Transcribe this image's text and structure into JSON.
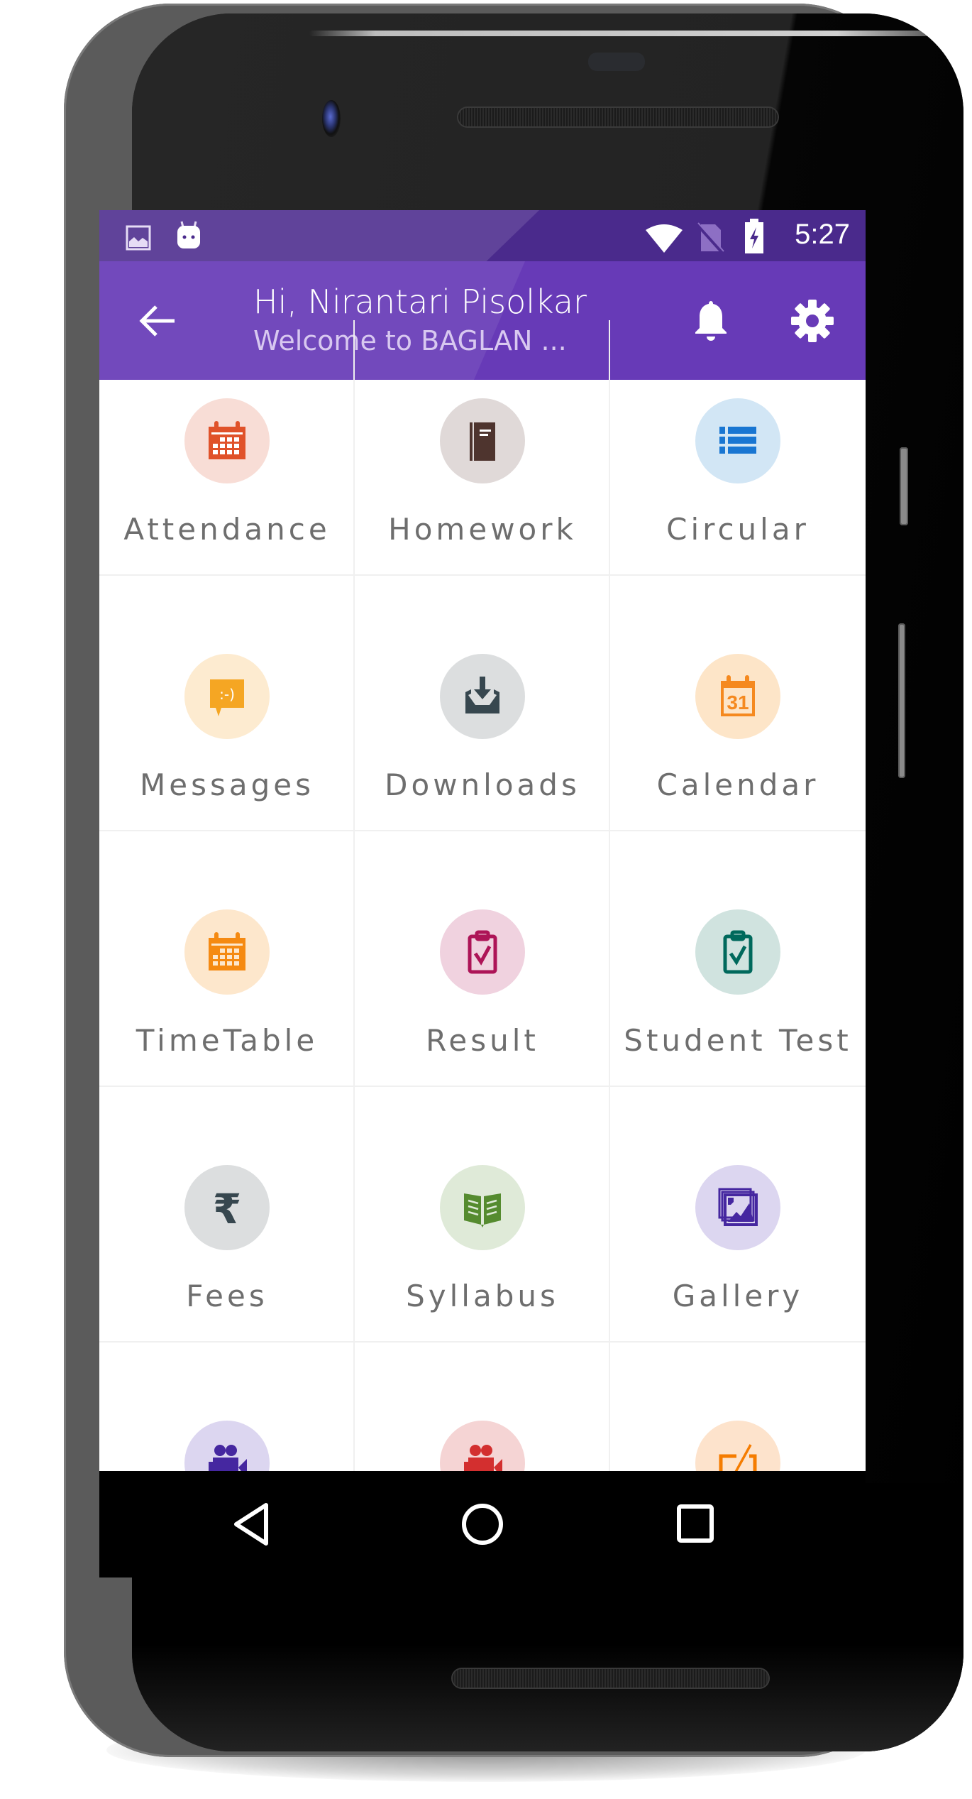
{
  "status_bar": {
    "left_icons": [
      "image-icon",
      "android-icon"
    ],
    "right_icons": [
      "wifi-icon",
      "no-sim-icon",
      "battery-charging-icon"
    ],
    "time": "5:27"
  },
  "app_bar": {
    "title": "Hi, Nirantari Pisolkar",
    "subtitle": "Welcome to BAGLAN ...",
    "back_icon": "arrow-back-icon",
    "actions": [
      "bell-icon",
      "gear-icon"
    ],
    "color": "#673ab7",
    "status_color": "#4a2a8c"
  },
  "menu": {
    "items": [
      {
        "label": "Attendance",
        "icon": "calendar-grid-icon",
        "bg": "#f8ddd6",
        "fg": "#e0522a"
      },
      {
        "label": "Homework",
        "icon": "book-icon",
        "bg": "#e0d9d8",
        "fg": "#4e342e"
      },
      {
        "label": "Circular",
        "icon": "list-icon",
        "bg": "#d2e6f5",
        "fg": "#1976d2"
      },
      {
        "label": "Messages",
        "icon": "chat-smiley-icon",
        "bg": "#fdebd0",
        "fg": "#f5a623"
      },
      {
        "label": "Downloads",
        "icon": "inbox-download-icon",
        "bg": "#dcdedf",
        "fg": "#37474f"
      },
      {
        "label": "Calendar",
        "icon": "calendar-31-icon",
        "bg": "#fde5c8",
        "fg": "#f5891f"
      },
      {
        "label": "TimeTable",
        "icon": "timetable-icon",
        "bg": "#fde7cc",
        "fg": "#f58a12"
      },
      {
        "label": "Result",
        "icon": "clipboard-check-icon",
        "bg": "#f0d2df",
        "fg": "#ad1457"
      },
      {
        "label": "Student Test",
        "icon": "clipboard-check-icon",
        "bg": "#d0e3df",
        "fg": "#00695c"
      },
      {
        "label": "Fees",
        "icon": "rupee-icon",
        "bg": "#dcdedf",
        "fg": "#37474f"
      },
      {
        "label": "Syllabus",
        "icon": "open-book-icon",
        "bg": "#dfead8",
        "fg": "#558b2f"
      },
      {
        "label": "Gallery",
        "icon": "photo-stack-icon",
        "bg": "#dcd6f0",
        "fg": "#4527a0"
      },
      {
        "label": "",
        "icon": "video-camera-icon",
        "bg": "#dcd6f0",
        "fg": "#4527a0"
      },
      {
        "label": "",
        "icon": "video-camera-icon",
        "bg": "#f5d4d4",
        "fg": "#d32f2f"
      },
      {
        "label": "",
        "icon": "edit-pad-icon",
        "bg": "#fde3cc",
        "fg": "#f57c00"
      }
    ]
  },
  "nav_bar": {
    "buttons": [
      "back-triangle-icon",
      "home-circle-icon",
      "recents-square-icon"
    ]
  },
  "rupee_glyph": "₹",
  "calendar_day": "31",
  "smiley_text": ":-)"
}
